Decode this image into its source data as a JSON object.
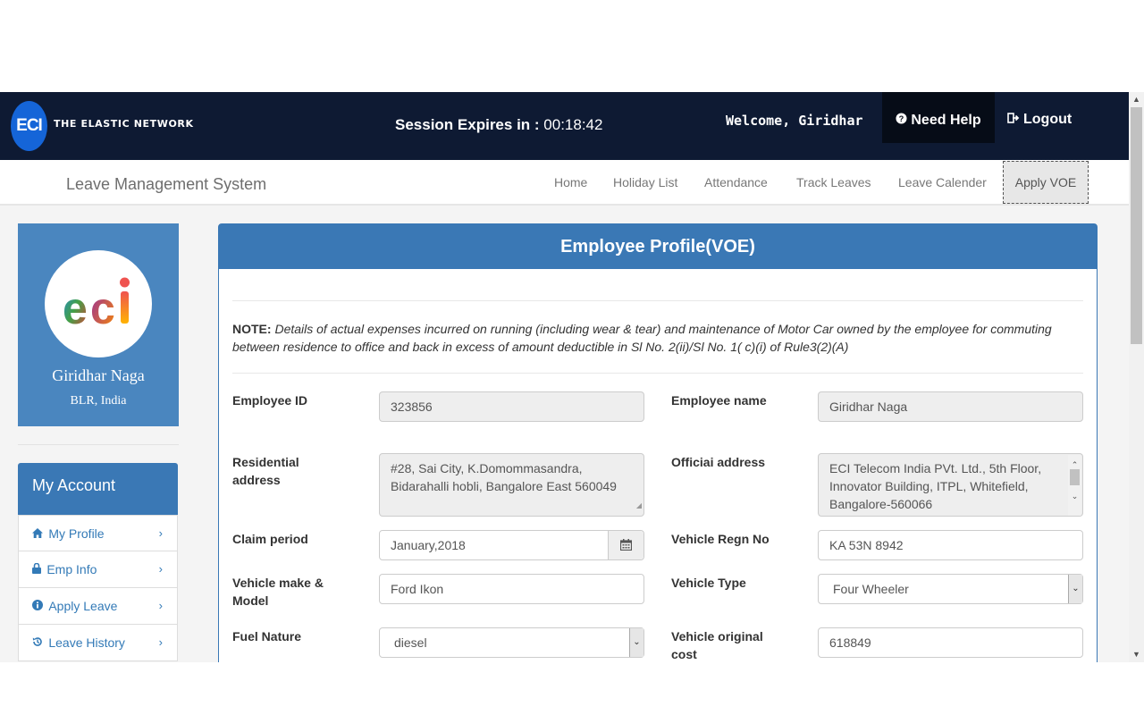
{
  "header": {
    "logo_badge": "ECI",
    "logo_text": "THE ELASTIC NETWORK",
    "session_label": "Session Expires in :",
    "session_time": "00:18:42",
    "welcome": "Welcome, Giridhar",
    "need_help": "Need Help",
    "logout": "Logout"
  },
  "nav": {
    "brand": "Leave Management System",
    "items": [
      "Home",
      "Holiday List",
      "Attendance",
      "Track Leaves",
      "Leave Calender",
      "Apply VOE"
    ],
    "active": "Apply VOE"
  },
  "profile": {
    "name": "Giridhar Naga",
    "location": "BLR, India",
    "logo_text": "eci"
  },
  "account": {
    "title": "My Account",
    "items": [
      "My Profile",
      "Emp Info",
      "Apply Leave",
      "Leave History"
    ]
  },
  "panel": {
    "title": "Employee Profile(VOE)",
    "note_label": "NOTE:",
    "note_text": "Details of actual expenses incurred on running (including wear & tear) and maintenance of Motor Car owned by the employee for commuting between residence to office and back in excess of amount deductible in Sl No. 2(ii)/Sl No. 1( c)(i) of Rule3(2)(A)"
  },
  "form": {
    "employee_id_label": "Employee ID",
    "employee_id": "323856",
    "employee_name_label": "Employee name",
    "employee_name": "Giridhar Naga",
    "residential_label_1": "Residential",
    "residential_label_2": "address",
    "residential_address": "#28, Sai City, K.Domommasandra, Bidarahalli hobli, Bangalore East 560049",
    "official_label": "Officiai address",
    "official_address": "ECI Telecom India PVt. Ltd., 5th Floor, Innovator Building, ITPL, Whitefield, Bangalore-560066",
    "claim_period_label": "Claim period",
    "claim_period": "January,2018",
    "vehicle_regn_label": "Vehicle Regn No",
    "vehicle_regn": "KA 53N 8942",
    "vehicle_make_label_1": "Vehicle make &",
    "vehicle_make_label_2": "Model",
    "vehicle_make": "Ford Ikon",
    "vehicle_type_label": "Vehicle Type",
    "vehicle_type": "Four Wheeler",
    "fuel_nature_label": "Fuel Nature",
    "fuel_nature": "diesel",
    "vehicle_cost_label_1": "Vehicle original",
    "vehicle_cost_label_2": "cost",
    "vehicle_cost": "618849"
  },
  "colors": {
    "header_bg": "#0e1a33",
    "primary": "#3a78b5",
    "profile_card": "#4a86bf",
    "link": "#337ab7"
  }
}
